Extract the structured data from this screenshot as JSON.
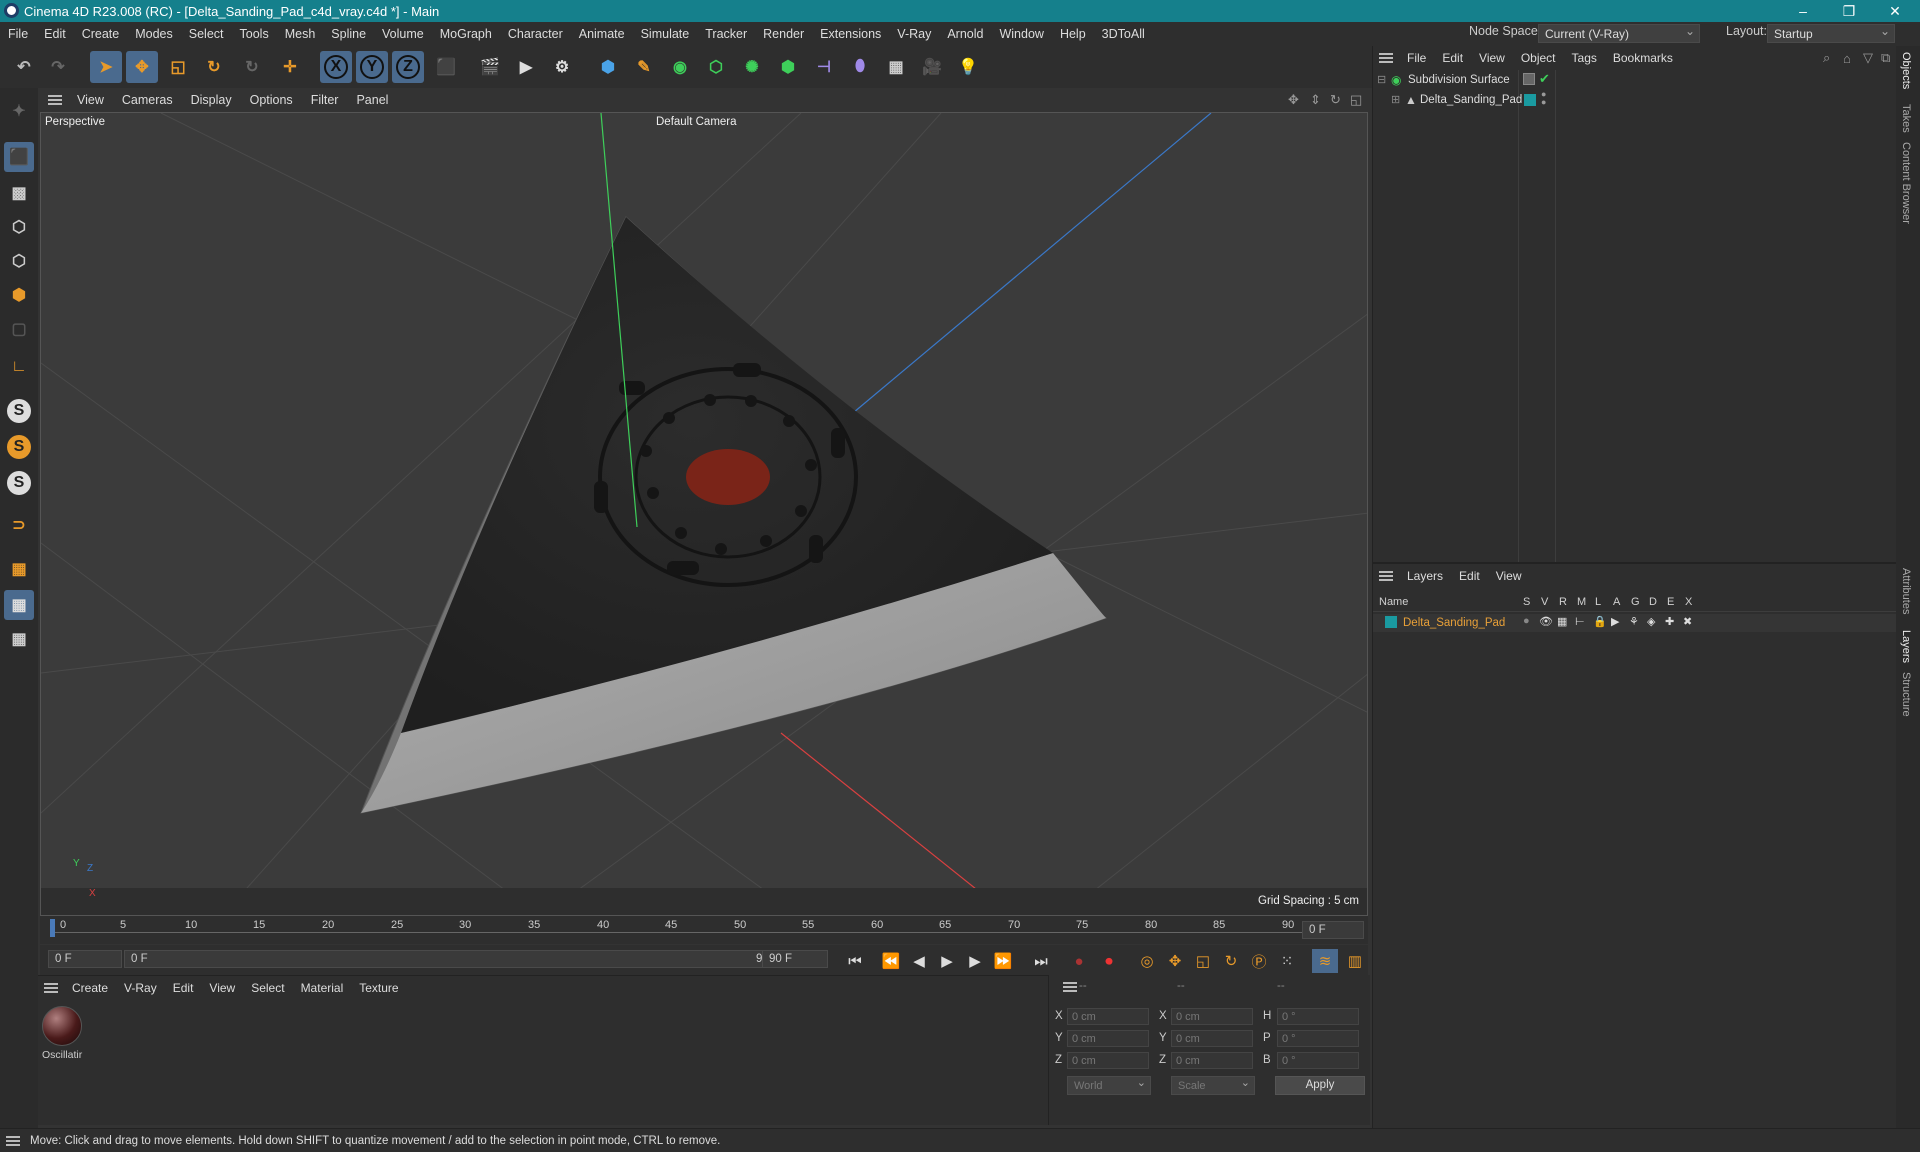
{
  "window": {
    "title": "Cinema 4D R23.008 (RC) - [Delta_Sanding_Pad_c4d_vray.c4d *] - Main",
    "minimize": "–",
    "maximize": "❐",
    "close": "✕"
  },
  "menubar": {
    "items": [
      "File",
      "Edit",
      "Create",
      "Modes",
      "Select",
      "Tools",
      "Mesh",
      "Spline",
      "Volume",
      "MoGraph",
      "Character",
      "Animate",
      "Simulate",
      "Tracker",
      "Render",
      "Extensions",
      "V-Ray",
      "Arnold",
      "Window",
      "Help",
      "3DToAll"
    ],
    "node_space_label": "Node Space:",
    "node_space_value": "Current (V-Ray)",
    "layout_label": "Layout:",
    "layout_value": "Startup"
  },
  "toolbar": {
    "axis_x": "X",
    "axis_y": "Y",
    "axis_z": "Z"
  },
  "viewport": {
    "menu": [
      "View",
      "Cameras",
      "Display",
      "Options",
      "Filter",
      "Panel"
    ],
    "name": "Perspective",
    "camera": "Default Camera",
    "grid_spacing": "Grid Spacing : 5 cm",
    "axis_y": "Y",
    "axis_z": "Z",
    "axis_x": "X"
  },
  "timeline": {
    "ticks": [
      "0",
      "5",
      "10",
      "15",
      "20",
      "25",
      "30",
      "35",
      "40",
      "45",
      "50",
      "55",
      "60",
      "65",
      "70",
      "75",
      "80",
      "85",
      "90"
    ],
    "current_frame": "0 F",
    "start_frame": "0 F",
    "range_start": "0 F",
    "range_end": "90 F",
    "end_frame": "90 F"
  },
  "material_panel": {
    "menu": [
      "Create",
      "V-Ray",
      "Edit",
      "View",
      "Select",
      "Material",
      "Texture"
    ],
    "materials": [
      {
        "name": "Oscillatir"
      }
    ]
  },
  "coord_panel": {
    "headers": [
      "--",
      "--",
      "--"
    ],
    "rows": [
      {
        "l1": "X",
        "v1": "0 cm",
        "l2": "X",
        "v2": "0 cm",
        "l3": "H",
        "v3": "0 °"
      },
      {
        "l1": "Y",
        "v1": "0 cm",
        "l2": "Y",
        "v2": "0 cm",
        "l3": "P",
        "v3": "0 °"
      },
      {
        "l1": "Z",
        "v1": "0 cm",
        "l2": "Z",
        "v2": "0 cm",
        "l3": "B",
        "v3": "0 °"
      }
    ],
    "world": "World",
    "scale": "Scale",
    "apply": "Apply"
  },
  "object_panel": {
    "menu": [
      "File",
      "Edit",
      "View",
      "Object",
      "Tags",
      "Bookmarks"
    ],
    "objects": [
      {
        "name": "Subdivision Surface"
      },
      {
        "name": "Delta_Sanding_Pad"
      }
    ]
  },
  "layer_panel": {
    "menu": [
      "Layers",
      "Edit",
      "View"
    ],
    "name_header": "Name",
    "flags": [
      "S",
      "V",
      "R",
      "M",
      "L",
      "A",
      "G",
      "D",
      "E",
      "X"
    ],
    "layers": [
      {
        "name": "Delta_Sanding_Pad",
        "color": "#1a9aa0"
      }
    ]
  },
  "right_tabs": [
    "Objects",
    "Takes",
    "Content Browser",
    "Attributes",
    "Layers",
    "Structure"
  ],
  "status": {
    "text": "Move: Click and drag to move elements. Hold down SHIFT to quantize movement / add to the selection in point mode, CTRL to remove."
  },
  "colors": {
    "titlebar": "#15808c",
    "accent_orange": "#e89a2a",
    "layer_text": "#e8a038",
    "axis_green": "#3ecf5a",
    "axis_red": "#d84040",
    "axis_blue": "#3a78c8"
  }
}
